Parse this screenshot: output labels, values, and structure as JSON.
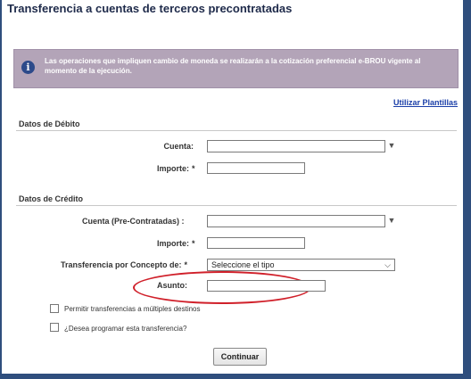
{
  "title": "Transferencia a cuentas de terceros precontratadas",
  "info": {
    "icon": "info-icon",
    "text": "Las operaciones que impliquen cambio de moneda se realizarán a la cotización preferencial e-BROU vigente al momento de la ejecución."
  },
  "templates_link": "Utilizar Plantillas",
  "debit": {
    "section": "Datos de Débito",
    "account_label": "Cuenta:",
    "amount_label": "Importe:",
    "required_mark": "*"
  },
  "credit": {
    "section": "Datos de Crédito",
    "account_label": "Cuenta (Pre-Contratadas) :",
    "amount_label": "Importe:",
    "concept_label": "Transferencia por Concepto de:",
    "concept_selected": "Seleccione el tipo",
    "subject_label": "Asunto:",
    "required_mark": "*"
  },
  "options": {
    "multiple_destinations": "Permitir transferencias a múltiples destinos",
    "schedule": "¿Desea programar esta transferencia?"
  },
  "continue_label": "Continuar",
  "colors": {
    "frame": "#2f4e7d",
    "info_bg": "#b3a4b8",
    "link": "#1a3ea8",
    "highlight": "#d0202a"
  }
}
